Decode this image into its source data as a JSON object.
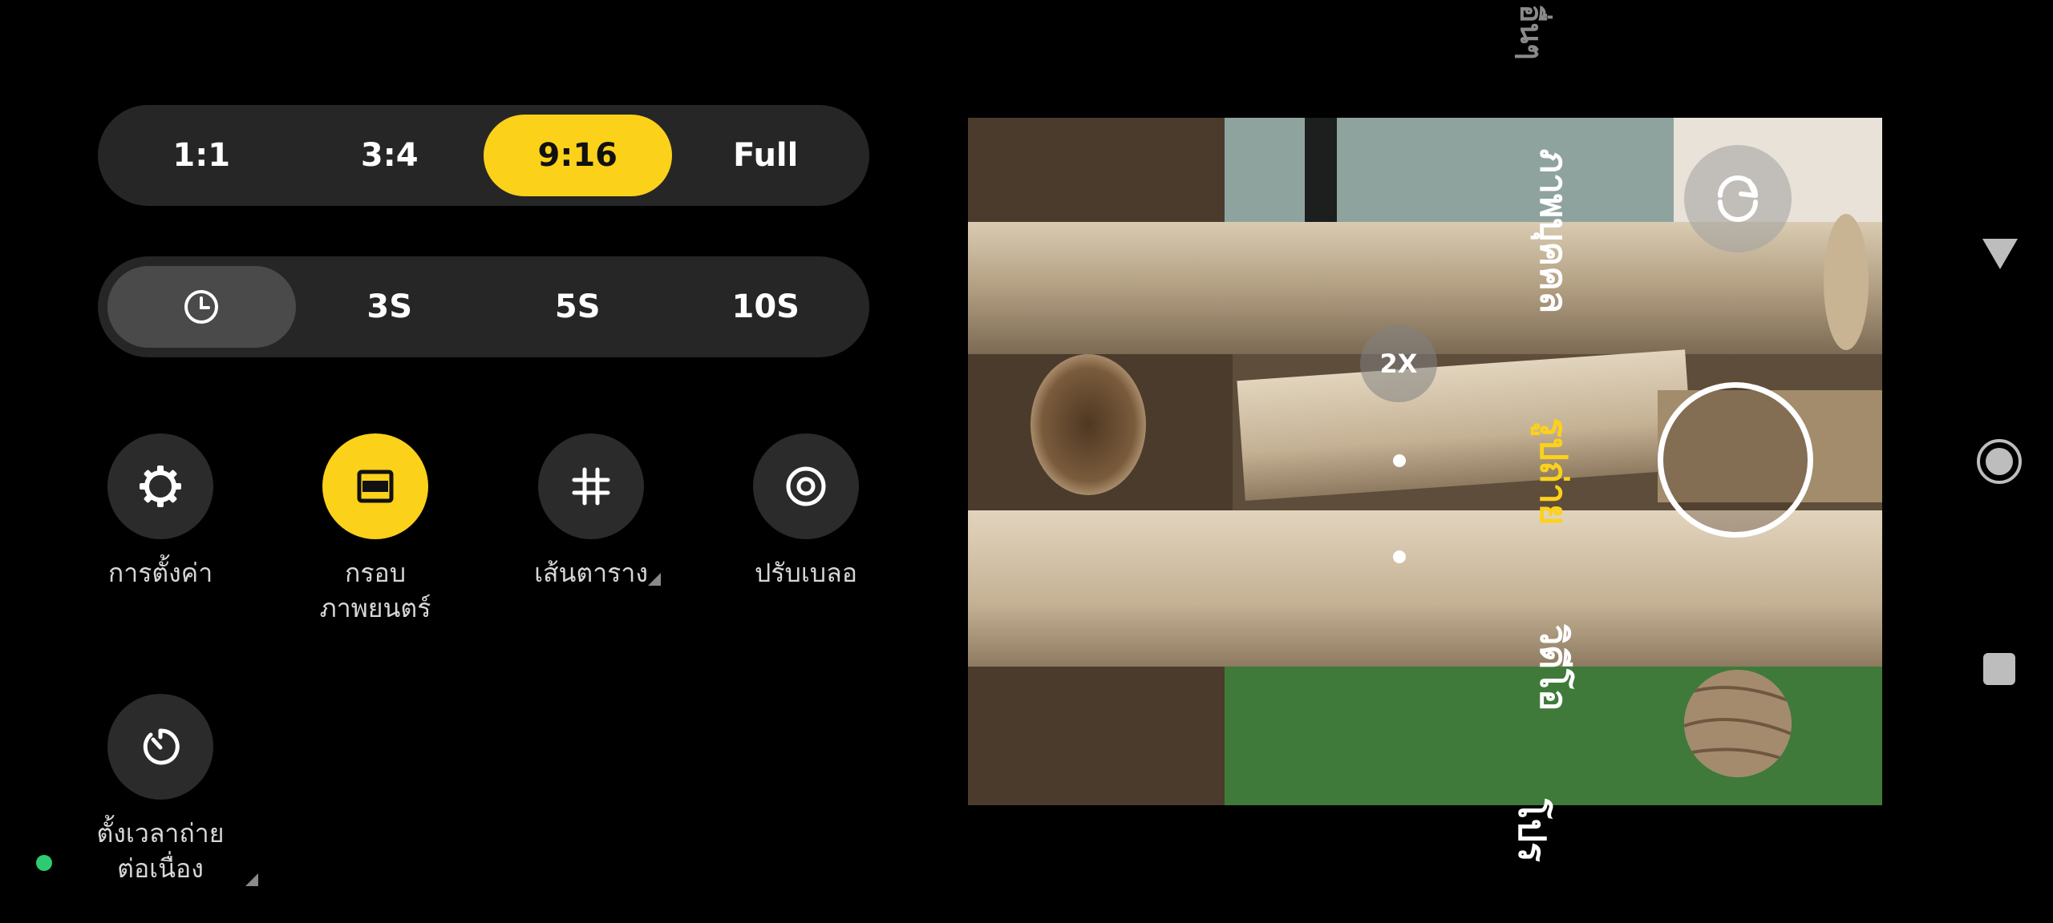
{
  "aspect_ratio": {
    "options": [
      "1:1",
      "3:4",
      "9:16",
      "Full"
    ],
    "selected": "9:16"
  },
  "timer": {
    "options": [
      "",
      "3S",
      "5S",
      "10S"
    ],
    "icon": "timer-off-icon",
    "selected_index": 0
  },
  "options": [
    {
      "label": "การตั้งค่า",
      "icon": "gear-icon",
      "active": false
    },
    {
      "label": "กรอบ\nภาพยนตร์",
      "icon": "cinema-frame-icon",
      "active": true
    },
    {
      "label": "เส้นตาราง",
      "icon": "grid-icon",
      "active": false,
      "has_submenu": true
    },
    {
      "label": "ปรับเบลอ",
      "icon": "blur-icon",
      "active": false
    },
    {
      "label": "ตั้งเวลาถ่าย\nต่อเนื่อง",
      "icon": "interval-timer-icon",
      "active": false,
      "has_submenu": true
    }
  ],
  "camera": {
    "zoom_label": "2X",
    "modes": [
      "ภาพบุคคล",
      "รูปถ่าย",
      "วิดีโอ",
      "โปร"
    ],
    "active_mode": "รูปถ่าย",
    "partial_mode_top": "อื่นๆ"
  },
  "colors": {
    "accent": "#fcd11a",
    "bar_bg": "#262626",
    "button_bg": "#2b2b2b",
    "status_dot": "#2ecc71"
  },
  "nav": {
    "back_icon": "back-triangle-icon",
    "home_icon": "home-circle-icon",
    "recents_icon": "recents-square-icon"
  }
}
